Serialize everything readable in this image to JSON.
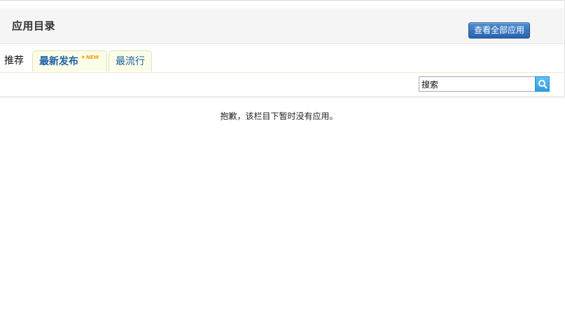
{
  "header": {
    "title": "应用目录",
    "view_all_label": "查看全部应用"
  },
  "tabs": [
    {
      "label": "推荐",
      "active": true
    },
    {
      "label": "最新发布",
      "badge": "NEW"
    },
    {
      "label": "最流行"
    }
  ],
  "search": {
    "value": "搜索",
    "icon": "search-icon"
  },
  "main": {
    "empty_message": "抱歉，该栏目下暂时没有应用。"
  },
  "colors": {
    "tab_text": "#1b5fa8",
    "button": "#2a63ad",
    "search_button": "#2f9be0",
    "badge": "#f0a000"
  }
}
